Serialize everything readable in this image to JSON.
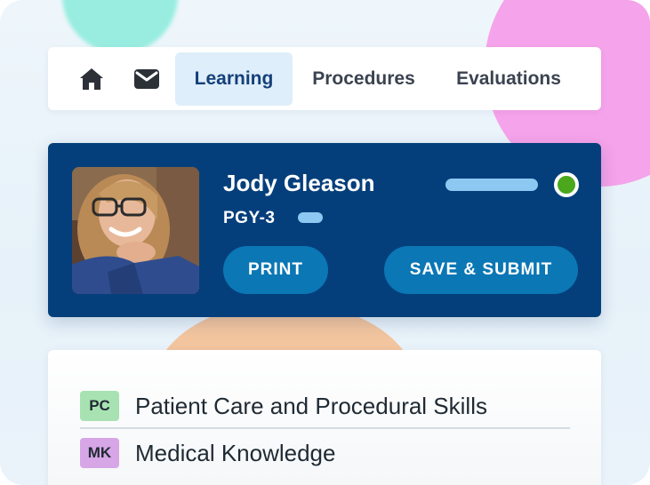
{
  "nav": {
    "icons": [
      "home-icon",
      "mail-icon"
    ],
    "tabs": [
      {
        "label": "Learning",
        "active": true
      },
      {
        "label": "Procedures",
        "active": false
      },
      {
        "label": "Evaluations",
        "active": false
      }
    ]
  },
  "profile": {
    "name": "Jody Gleason",
    "level": "PGY-3",
    "status_color": "#4ba81c",
    "print_label": "PRINT",
    "submit_label": "SAVE & SUBMIT"
  },
  "competencies": [
    {
      "code": "PC",
      "label": "Patient Care and Procedural Skills",
      "badge_color": "#a8e2b2"
    },
    {
      "code": "MK",
      "label": "Medical Knowledge",
      "badge_color": "#d6a6e6"
    }
  ],
  "colors": {
    "card_navy": "#053f7b",
    "button_blue": "#0b77b5",
    "active_tab_bg": "#deeefa"
  }
}
